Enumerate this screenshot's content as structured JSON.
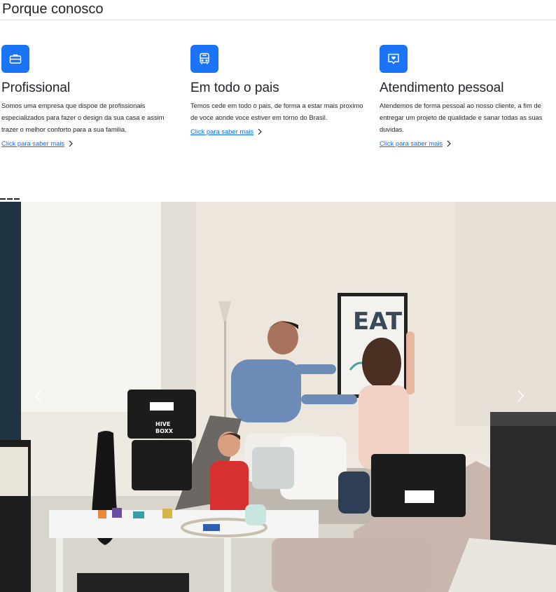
{
  "section": {
    "title": "Porque conosco"
  },
  "features": [
    {
      "icon": "briefcase-icon",
      "title": "Profissional",
      "text": "Somos uma empresa que dispoe de profissionais especializados para fazer o design da sua casa e assim trazer o melhor conforto para a sua familia.",
      "link": "Click para saber mais"
    },
    {
      "icon": "bus-icon",
      "title": "Em todo o pais",
      "text": "Temos cede em todo o pais, de forma a estar mais proximo de voce aonde voce estiver em torno do Brasil.",
      "link": "Click para saber mais"
    },
    {
      "icon": "heart-chat-icon",
      "title": "Atendimento pessoal",
      "text": "Atendemos de forma pessoal ao nosso cliente, a fim de entregar um projeto de qualidade e sanar todas as suas duvidas.",
      "link": "Click para saber mais"
    }
  ],
  "carousel": {
    "poster_text": "EAT",
    "box_label_1": "HIVE",
    "box_label_2": "BOXX",
    "prev_icon": "chevron-left-icon",
    "next_icon": "chevron-right-icon"
  },
  "colors": {
    "accent": "#1b73f5",
    "link": "#0d6efd",
    "text": "#212529"
  }
}
